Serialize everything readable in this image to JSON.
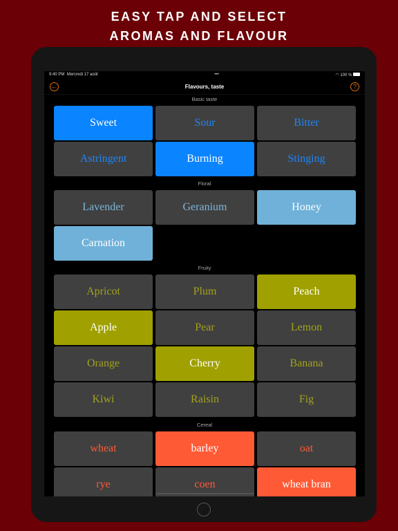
{
  "headline": [
    "EASY TAP AND SELECT",
    "AROMAS AND FLAVOUR"
  ],
  "status": {
    "time": "9:40 PM",
    "date": "Mercredi 17 août",
    "dots": "•••",
    "battery": "100 %"
  },
  "nav": {
    "title": "Flavours, taste",
    "back_icon": "back-arrow-circle-icon",
    "help_icon": "question-circle-icon"
  },
  "colors": {
    "background": "#6b0006",
    "blue": "#0a84ff",
    "lightblue": "#6fb1d9",
    "olive": "#a0a000",
    "orange": "#ff5a36",
    "tile": "#404040"
  },
  "sections": [
    {
      "label": "Basic taste",
      "selected_color": "#0a84ff",
      "text_color": "#1f86f5",
      "items": [
        {
          "label": "Sweet",
          "selected": true
        },
        {
          "label": "Sour",
          "selected": false
        },
        {
          "label": "Bitter",
          "selected": false
        },
        {
          "label": "Astringent",
          "selected": false
        },
        {
          "label": "Burning",
          "selected": true
        },
        {
          "label": "Stinging",
          "selected": false
        }
      ]
    },
    {
      "label": "Floral",
      "selected_color": "#6fb1d9",
      "text_color": "#7db6dd",
      "items": [
        {
          "label": "Lavender",
          "selected": false
        },
        {
          "label": "Geranium",
          "selected": false
        },
        {
          "label": "Honey",
          "selected": true
        },
        {
          "label": "Carnation",
          "selected": true
        }
      ]
    },
    {
      "label": "Fruity",
      "selected_color": "#a0a000",
      "text_color": "#a3a21b",
      "items": [
        {
          "label": "Apricot",
          "selected": false
        },
        {
          "label": "Plum",
          "selected": false
        },
        {
          "label": "Peach",
          "selected": true
        },
        {
          "label": "Apple",
          "selected": true
        },
        {
          "label": "Pear",
          "selected": false
        },
        {
          "label": "Lemon",
          "selected": false
        },
        {
          "label": "Orange",
          "selected": false
        },
        {
          "label": "Cherry",
          "selected": true
        },
        {
          "label": "Banana",
          "selected": false
        },
        {
          "label": "Kiwi",
          "selected": false
        },
        {
          "label": "Raisin",
          "selected": false
        },
        {
          "label": "Fig",
          "selected": false
        }
      ]
    },
    {
      "label": "Cereal",
      "selected_color": "#ff5a36",
      "text_color": "#ff5a36",
      "items": [
        {
          "label": "wheat",
          "selected": false
        },
        {
          "label": "barley",
          "selected": true
        },
        {
          "label": "oat",
          "selected": false
        },
        {
          "label": "rye",
          "selected": false
        },
        {
          "label": "coen",
          "selected": false
        },
        {
          "label": "wheat bran",
          "selected": true
        }
      ]
    }
  ]
}
